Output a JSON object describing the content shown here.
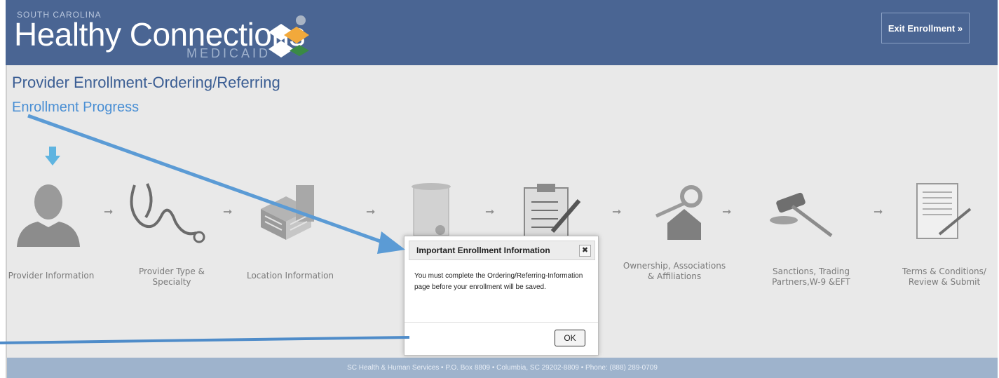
{
  "header": {
    "state": "SOUTH CAROLINA",
    "brand": "Healthy Connections",
    "program": "MEDICAID",
    "exit_label": "Exit Enrollment »"
  },
  "page": {
    "title": "Provider Enrollment-Ordering/Referring",
    "progress_title": "Enrollment Progress"
  },
  "steps": [
    {
      "label": "Provider Information",
      "icon": "person-icon"
    },
    {
      "label": "Provider Type & Specialty",
      "icon": "stethoscope-icon"
    },
    {
      "label": "Location Information",
      "icon": "building-icon"
    },
    {
      "label": "",
      "icon": "scroll-icon"
    },
    {
      "label": "",
      "icon": "clipboard-icon"
    },
    {
      "label": "Ownership, Associations & Affiliations",
      "icon": "house-key-icon"
    },
    {
      "label": "Sanctions, Trading Partners,W-9 &EFT",
      "icon": "gavel-icon"
    },
    {
      "label": "Terms & Conditions/ Review & Submit",
      "icon": "document-sign-icon"
    }
  ],
  "dialog": {
    "title": "Important Enrollment Information",
    "close": "✖",
    "message": "You must complete the Ordering/Referring-Information page before your enrollment will be saved.",
    "ok_label": "OK"
  },
  "footer": {
    "text": "SC Health & Human Services • P.O. Box 8809 • Columbia, SC 29202-8809 • Phone: (888) 289-0709"
  },
  "colors": {
    "header_bg": "#4a6593",
    "title": "#3a5d93",
    "accent": "#4a8fd4",
    "annotation": "#5b9bd5"
  }
}
